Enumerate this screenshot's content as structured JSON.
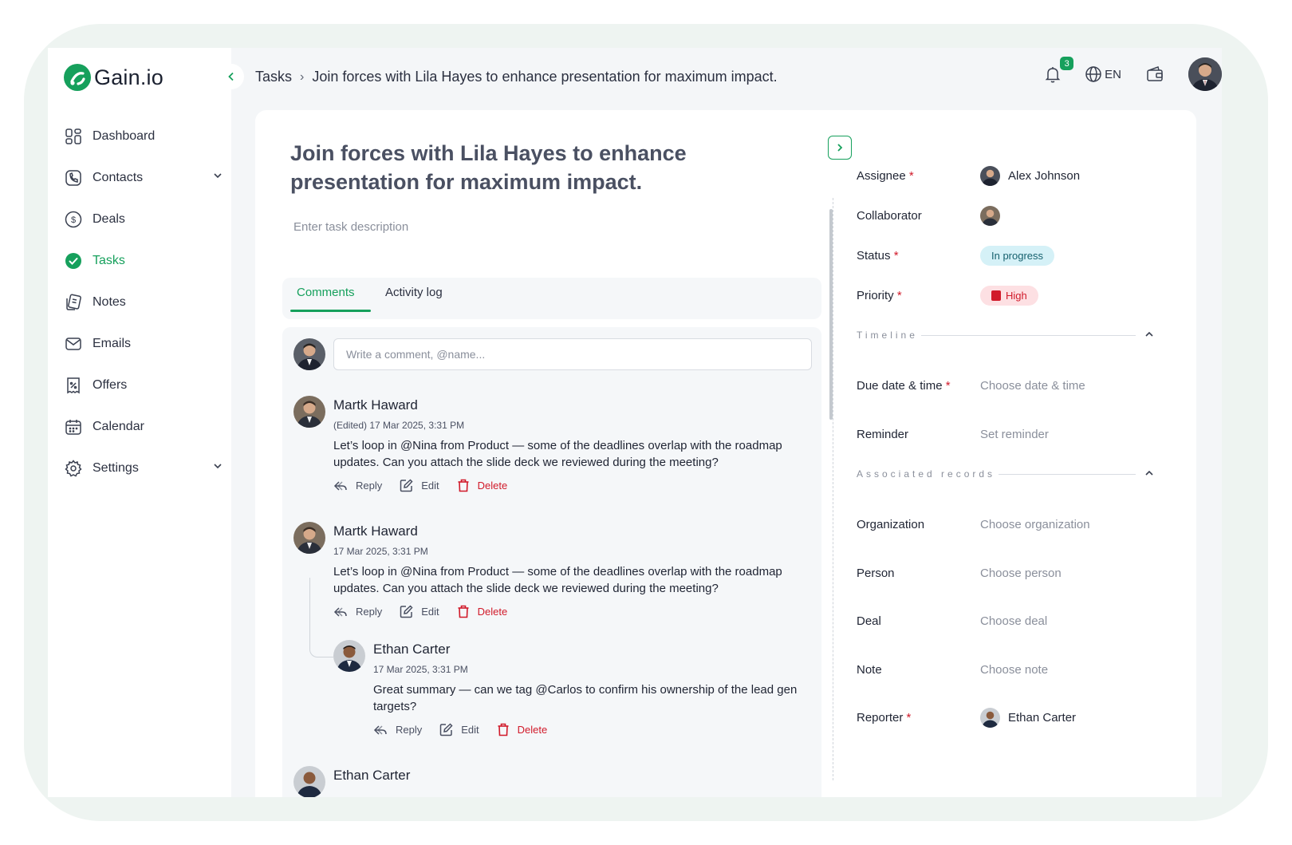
{
  "app": {
    "brand": "Gain.io",
    "accent": "#16a05c"
  },
  "sidebar": {
    "items": [
      {
        "label": "Dashboard",
        "icon": "dashboard-icon"
      },
      {
        "label": "Contacts",
        "icon": "contacts-icon",
        "expandable": true
      },
      {
        "label": "Deals",
        "icon": "dollar-icon"
      },
      {
        "label": "Tasks",
        "icon": "check-circle-icon",
        "active": true
      },
      {
        "label": "Notes",
        "icon": "notes-icon"
      },
      {
        "label": "Emails",
        "icon": "mail-icon"
      },
      {
        "label": "Offers",
        "icon": "offer-icon"
      },
      {
        "label": "Calendar",
        "icon": "calendar-icon"
      },
      {
        "label": "Settings",
        "icon": "gear-icon",
        "expandable": true
      }
    ]
  },
  "breadcrumb": {
    "root": "Tasks",
    "current": "Join forces with Lila Hayes to enhance presentation for maximum impact."
  },
  "topbar": {
    "notifications": "3",
    "language": "EN"
  },
  "task": {
    "title": "Join forces with Lila Hayes to enhance presentation for maximum impact.",
    "description_placeholder": "Enter task description"
  },
  "tabs": [
    {
      "label": "Comments",
      "active": true
    },
    {
      "label": "Activity log"
    }
  ],
  "compose": {
    "placeholder": "Write a comment, @name..."
  },
  "comments": [
    {
      "author": "Martk Haward",
      "meta": "(Edited) 17 Mar 2025, 3:31 PM",
      "text": "Let’s loop in @Nina from Product — some of the deadlines overlap with the roadmap updates. Can you attach the slide deck we reviewed during the meeting?"
    },
    {
      "author": "Martk Haward",
      "meta": "17 Mar 2025, 3:31 PM",
      "text": "Let’s loop in @Nina from Product — some of the deadlines overlap with the roadmap updates. Can you attach the slide deck we reviewed during the meeting?"
    },
    {
      "author": "Ethan Carter",
      "meta": "17 Mar 2025, 3:31 PM",
      "text": "Great summary — can we tag @Carlos to confirm his ownership of the lead gen targets?",
      "reply": true
    },
    {
      "author": "Ethan Carter"
    }
  ],
  "actions": {
    "reply": "Reply",
    "edit": "Edit",
    "delete": "Delete"
  },
  "details": {
    "assignee": {
      "label": "Assignee",
      "value": "Alex Johnson"
    },
    "collaborator": {
      "label": "Collaborator"
    },
    "status": {
      "label": "Status",
      "value": "In progress"
    },
    "priority": {
      "label": "Priority",
      "value": "High"
    },
    "timeline_heading": "Timeline",
    "due": {
      "label": "Due date & time",
      "placeholder": "Choose date & time"
    },
    "reminder": {
      "label": "Reminder",
      "placeholder": "Set reminder"
    },
    "associated_heading": "Associated records",
    "organization": {
      "label": "Organization",
      "placeholder": "Choose organization"
    },
    "person": {
      "label": "Person",
      "placeholder": "Choose person"
    },
    "deal": {
      "label": "Deal",
      "placeholder": "Choose deal"
    },
    "note": {
      "label": "Note",
      "placeholder": "Choose note"
    },
    "reporter": {
      "label": "Reporter",
      "value": "Ethan Carter"
    },
    "required_mark": "*"
  }
}
